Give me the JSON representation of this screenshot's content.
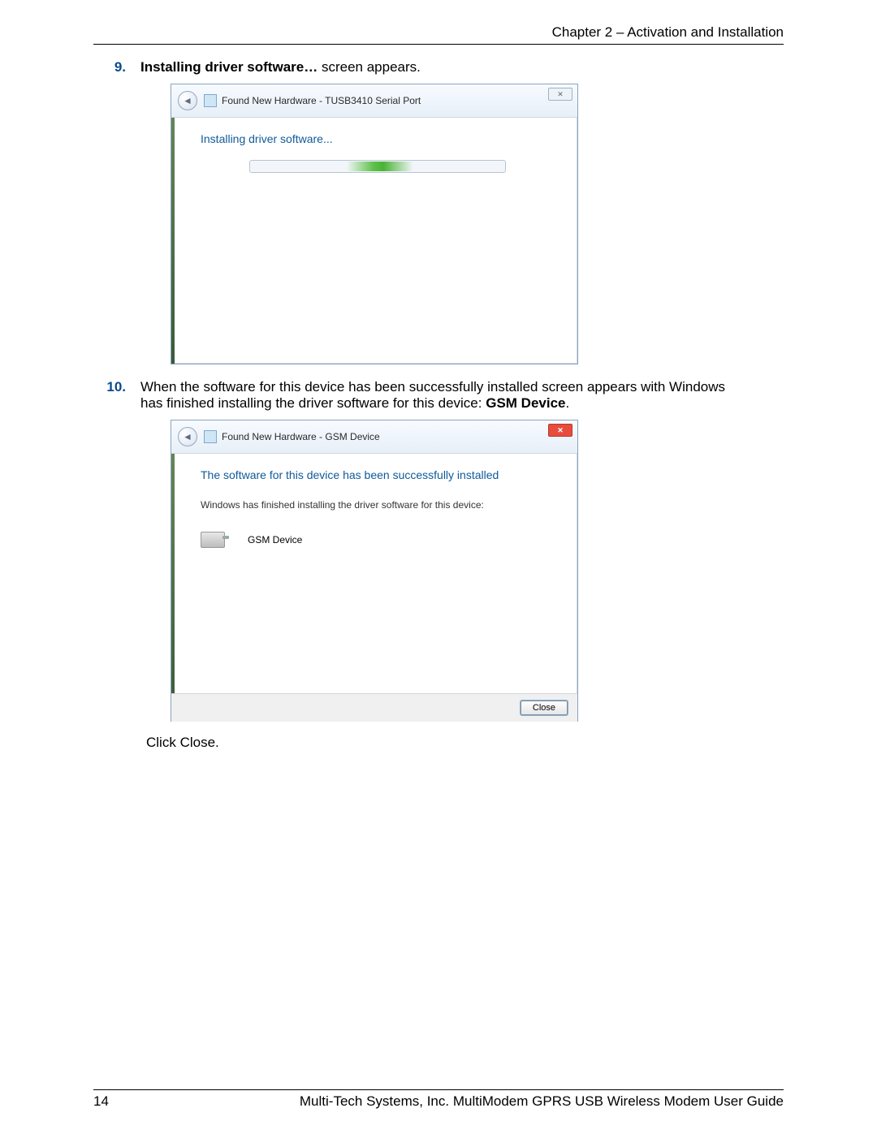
{
  "header": {
    "chapter": "Chapter 2 – Activation and Installation"
  },
  "step9": {
    "num": "9.",
    "bold": "Installing driver software…",
    "rest": " screen appears."
  },
  "dialog1": {
    "title": "Found New Hardware - TUSB3410 Serial Port",
    "heading": "Installing driver software...",
    "close_glyph": "✕"
  },
  "step10": {
    "num": "10.",
    "line1a": "When the software for this device has been successfully installed screen appears with Windows",
    "line1b": "has finished installing the driver software for this device: ",
    "bold_end": "GSM Device",
    "period": "."
  },
  "dialog2": {
    "title": "Found New Hardware - GSM Device",
    "heading": "The software for this device has been successfully installed",
    "subtext": "Windows has finished installing the driver software for this device:",
    "device": "GSM Device",
    "close_glyph": "✕",
    "button": "Close"
  },
  "click_close": {
    "pre": "Click ",
    "bold": "Close."
  },
  "footer": {
    "page": "14",
    "text": "Multi-Tech Systems, Inc. MultiModem GPRS USB Wireless Modem User Guide"
  }
}
